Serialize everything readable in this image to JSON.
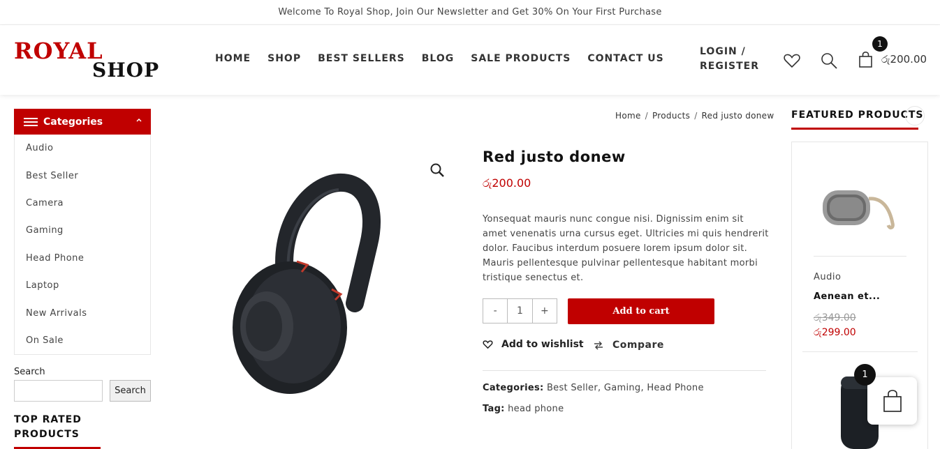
{
  "topbar": {
    "text": "Welcome To Royal Shop, Join Our Newsletter and Get 30% On Your First Purchase"
  },
  "logo": {
    "line1": "ROYAL",
    "line2": "SHOP"
  },
  "nav": {
    "items": [
      "HOME",
      "SHOP",
      "BEST SELLERS",
      "BLOG",
      "SALE PRODUCTS",
      "CONTACT US"
    ]
  },
  "account": {
    "login": "LOGIN /",
    "register": "REGISTER"
  },
  "cart": {
    "count": "1",
    "total": "රු200.00"
  },
  "categories": {
    "title": "Categories",
    "items": [
      "Audio",
      "Best Seller",
      "Camera",
      "Gaming",
      "Head Phone",
      "Laptop",
      "New Arrivals",
      "On Sale"
    ]
  },
  "search": {
    "label": "Search",
    "button": "Search",
    "value": ""
  },
  "top_rated": {
    "title": "TOP RATED PRODUCTS"
  },
  "breadcrumb": {
    "items": [
      "Home",
      "Products",
      "Red justo donew"
    ],
    "separator": "/"
  },
  "product": {
    "title": "Red justo donew",
    "price": "රු200.00",
    "description": "Yonsequat mauris nunc congue nisi. Dignissim enim sit amet venenatis urna cursus eget. Ultricies mi quis hendrerit dolor. Faucibus interdum posuere lorem ipsum dolor sit. Mauris pellentesque pulvinar pellentesque habitant morbi tristique senectus et.",
    "qty": {
      "minus": "-",
      "value": "1",
      "plus": "+"
    },
    "add_to_cart": "Add to cart",
    "wishlist": "Add to wishlist",
    "compare": "Compare",
    "categories_label": "Categories:",
    "categories": [
      "Best Seller",
      "Gaming",
      "Head Phone"
    ],
    "tag_label": "Tag:",
    "tag": "head phone"
  },
  "featured": {
    "title": "FEATURED PRODUCTS",
    "item": {
      "category": "Audio",
      "name": "Aenean et...",
      "old_price": "රු349.00",
      "price": "රු299.00"
    }
  },
  "floating_cart": {
    "count": "1"
  },
  "colors": {
    "accent": "#c00000",
    "text": "#222222",
    "badge": "#111111"
  }
}
